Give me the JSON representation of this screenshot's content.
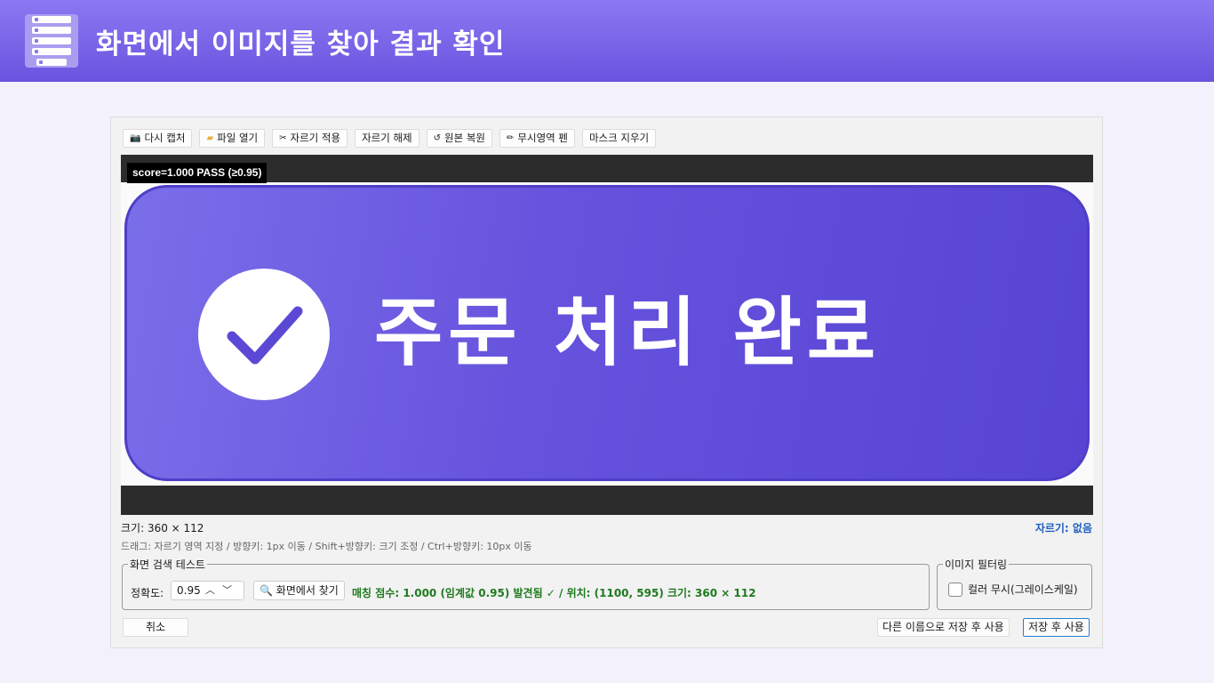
{
  "header": {
    "title": "화면에서 이미지를 찾아 결과 확인",
    "icon": "list-app-icon"
  },
  "toolbar": {
    "recapture": {
      "label": "다시 캡처",
      "icon": "camera-icon"
    },
    "open_file": {
      "label": "파일 열기",
      "icon": "folder-icon"
    },
    "apply_crop": {
      "label": "자르기 적용",
      "icon": "scissors-icon"
    },
    "clear_crop": {
      "label": "자르기 해제"
    },
    "restore": {
      "label": "원본 복원",
      "icon": "undo-icon"
    },
    "ignore_pen": {
      "label": "무시영역 펜",
      "icon": "pen-icon"
    },
    "clear_mask": {
      "label": "마스크 지우기"
    }
  },
  "viewer": {
    "score_label": "score=1.000  PASS (≥0.95)",
    "button_text": "주문 처리 완료",
    "button_color": "#6552dd"
  },
  "info": {
    "size": "크기: 360 × 112",
    "crop": "자르기: 없음",
    "help": "드래그: 자르기 영역 지정 / 방향키: 1px 이동 / Shift+방향키: 크기 조정 / Ctrl+방향키: 10px 이동"
  },
  "search": {
    "legend": "화면 검색 테스트",
    "accuracy_label": "정확도:",
    "accuracy_value": "0.95",
    "find_button": "화면에서 찾기",
    "result": "매칭 점수: 1.000  (임계값 0.95) 발견됨 ✓ / 위치: (1100, 595)  크기: 360 × 112",
    "result_color": "#1e7a1e"
  },
  "filter": {
    "legend": "이미지 필터링",
    "ignore_color_label": "컬러 무시(그레이스케일)",
    "ignore_color_checked": false
  },
  "footer": {
    "cancel": "취소",
    "save_as": "다른 이름으로 저장 후 사용",
    "save": "저장 후 사용"
  }
}
